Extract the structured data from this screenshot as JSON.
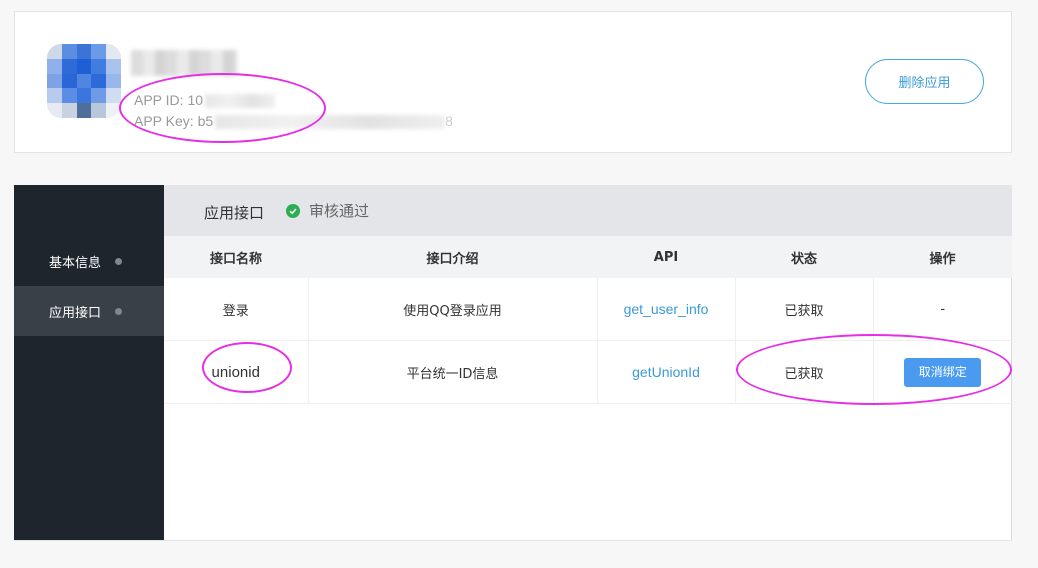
{
  "app": {
    "id_label": "APP ID:",
    "id_prefix": "10",
    "key_label": "APP Key:",
    "key_prefix": "b5",
    "key_suffix": "8",
    "delete_label": "删除应用"
  },
  "sidebar": {
    "items": [
      {
        "label": "基本信息",
        "active": false
      },
      {
        "label": "应用接口",
        "active": true
      }
    ]
  },
  "content": {
    "tab_title": "应用接口",
    "status": "审核通过",
    "status_color": "#2cae53"
  },
  "table": {
    "headers": [
      "接口名称",
      "接口介绍",
      "API",
      "状态",
      "操作"
    ],
    "rows": [
      {
        "name": "登录",
        "desc": "使用QQ登录应用",
        "api": "get_user_info",
        "status": "已获取",
        "action": "-"
      },
      {
        "name": "unionid",
        "desc": "平台统一ID信息",
        "api": "getUnionId",
        "status": "已获取",
        "action": "取消绑定"
      }
    ]
  },
  "colors": {
    "sidebar_bg": "#1f252d",
    "accent": "#3a9bd9",
    "button_blue": "#4a9bf0",
    "annotation": "#e52ee5"
  }
}
